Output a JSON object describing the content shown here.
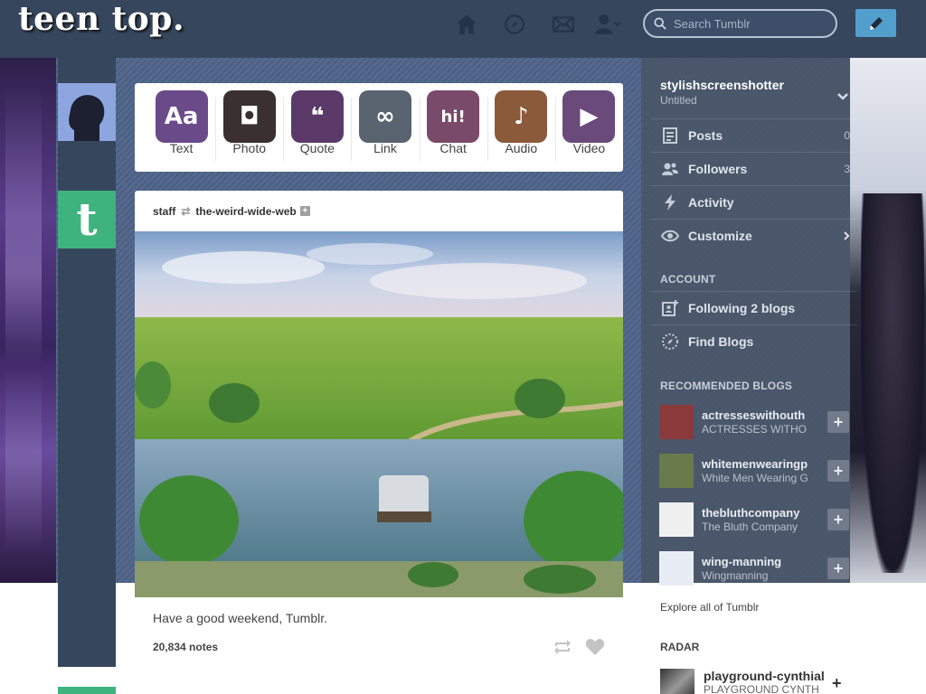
{
  "header": {
    "logo": "teen top.",
    "search_placeholder": "Search Tumblr",
    "nav_icons": [
      "home-icon",
      "compass-icon",
      "mail-icon",
      "account-icon"
    ],
    "compose_icon": "pencil-icon",
    "bg_color": "#36465d"
  },
  "post_types": [
    {
      "label": "Text",
      "glyph": "Aa",
      "color": "#6b4a8a"
    },
    {
      "label": "Photo",
      "glyph": "◘",
      "color": "#3a3030"
    },
    {
      "label": "Quote",
      "glyph": "❝",
      "color": "#5b3a6a"
    },
    {
      "label": "Link",
      "glyph": "∞",
      "color": "#5a6470"
    },
    {
      "label": "Chat",
      "glyph": "hi!",
      "color": "#7a4a6a"
    },
    {
      "label": "Audio",
      "glyph": "♪",
      "color": "#8a5a3a"
    },
    {
      "label": "Video",
      "glyph": "▶",
      "color": "#6a4a7a"
    }
  ],
  "post": {
    "author": "staff",
    "reblogged_from": "the-weird-wide-web",
    "caption": "Have a good weekend, Tumblr.",
    "notes": "20,834 notes"
  },
  "sidebar": {
    "blog_name": "stylishscreenshotter",
    "blog_subtitle": "Untitled",
    "items": [
      {
        "label": "Posts",
        "count": "0",
        "icon": "posts-icon"
      },
      {
        "label": "Followers",
        "count": "3",
        "icon": "followers-icon"
      },
      {
        "label": "Activity",
        "count": "",
        "icon": "activity-icon"
      },
      {
        "label": "Customize",
        "count": "",
        "icon": "eye-icon"
      }
    ],
    "account_heading": "ACCOUNT",
    "account_items": [
      {
        "label": "Following 2 blogs",
        "icon": "following-icon"
      },
      {
        "label": "Find Blogs",
        "icon": "find-blogs-icon"
      }
    ],
    "recommended_heading": "RECOMMENDED BLOGS",
    "recommended": [
      {
        "name": "actresseswithouth",
        "title": "ACTRESSES WITHO",
        "color": "#8a3a3a"
      },
      {
        "name": "whitemenwearingp",
        "title": "White Men Wearing G",
        "color": "#6a7a4a"
      },
      {
        "name": "thebluthcompany",
        "title": "The Bluth Company",
        "color": "#f0f0f0"
      },
      {
        "name": "wing-manning",
        "title": "Wingmanning",
        "color": "#e8ecf4"
      }
    ],
    "explore": "Explore all of Tumblr",
    "radar_heading": "RADAR",
    "radar": {
      "name": "playground-cynthial",
      "title": "PLAYGROUND CYNTH"
    }
  }
}
